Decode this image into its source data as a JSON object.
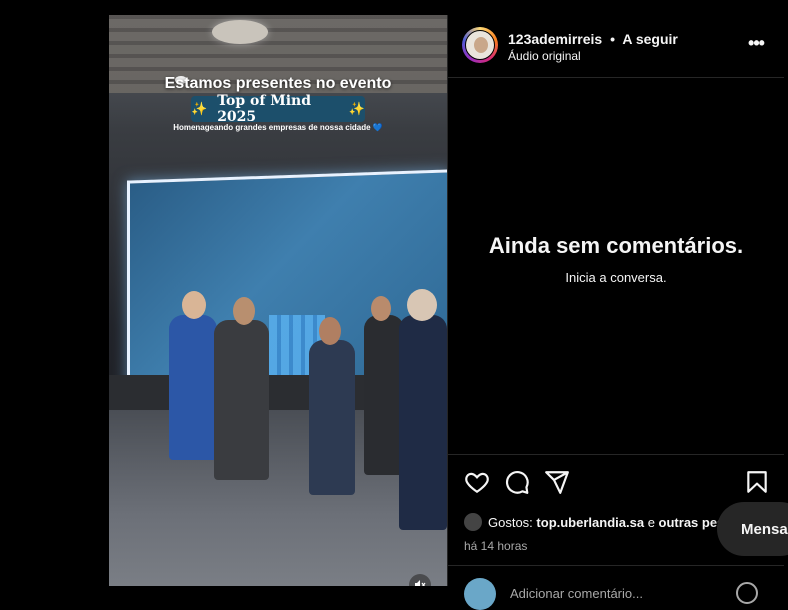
{
  "video": {
    "title": "Estamos presentes no evento",
    "badge_text": "Top of Mind 2025",
    "sparkle": "✨",
    "subtitle": "Homenageando grandes empresas de nossa cidade",
    "subtitle_emoji": "💙"
  },
  "header": {
    "username": "123ademirreis",
    "separator": "•",
    "follow_label": "A seguir",
    "audio_label": "Áudio original",
    "more_icon": "•••"
  },
  "comments": {
    "empty_title": "Ainda sem comentários.",
    "empty_subtitle": "Inicia a conversa."
  },
  "actions": {
    "likes_prefix": "Gostos:",
    "liked_by": "top.uberlandia.sa",
    "likes_joiner": "e",
    "likes_others": "outras pessoas",
    "time_ago": "há 14 horas",
    "comment_placeholder": "Adicionar comentário..."
  },
  "messages": {
    "label": "Mensagens"
  },
  "colors": {
    "background": "#000000",
    "text": "#f5f5f5",
    "muted": "#a8a8a8",
    "divider": "#262626"
  }
}
